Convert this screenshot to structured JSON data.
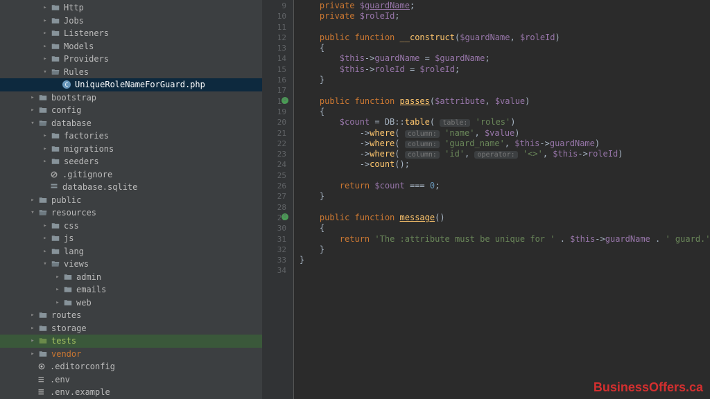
{
  "tree": [
    {
      "depth": 3,
      "chev": "right",
      "icon": "folder",
      "label": "Http"
    },
    {
      "depth": 3,
      "chev": "right",
      "icon": "folder",
      "label": "Jobs"
    },
    {
      "depth": 3,
      "chev": "right",
      "icon": "folder",
      "label": "Listeners"
    },
    {
      "depth": 3,
      "chev": "right",
      "icon": "folder",
      "label": "Models"
    },
    {
      "depth": 3,
      "chev": "right",
      "icon": "folder",
      "label": "Providers"
    },
    {
      "depth": 3,
      "chev": "down",
      "icon": "folder-open",
      "label": "Rules"
    },
    {
      "depth": 4,
      "chev": "none",
      "icon": "php",
      "label": "UniqueRoleNameForGuard.php",
      "selected": true
    },
    {
      "depth": 2,
      "chev": "right",
      "icon": "folder",
      "label": "bootstrap"
    },
    {
      "depth": 2,
      "chev": "right",
      "icon": "folder",
      "label": "config"
    },
    {
      "depth": 2,
      "chev": "down",
      "icon": "folder-open",
      "label": "database"
    },
    {
      "depth": 3,
      "chev": "right",
      "icon": "folder",
      "label": "factories"
    },
    {
      "depth": 3,
      "chev": "right",
      "icon": "folder",
      "label": "migrations"
    },
    {
      "depth": 3,
      "chev": "right",
      "icon": "folder",
      "label": "seeders"
    },
    {
      "depth": 3,
      "chev": "none",
      "icon": "gitignore",
      "label": ".gitignore"
    },
    {
      "depth": 3,
      "chev": "none",
      "icon": "db",
      "label": "database.sqlite"
    },
    {
      "depth": 2,
      "chev": "right",
      "icon": "folder",
      "label": "public"
    },
    {
      "depth": 2,
      "chev": "down",
      "icon": "folder-open",
      "label": "resources"
    },
    {
      "depth": 3,
      "chev": "right",
      "icon": "folder",
      "label": "css"
    },
    {
      "depth": 3,
      "chev": "right",
      "icon": "folder",
      "label": "js"
    },
    {
      "depth": 3,
      "chev": "right",
      "icon": "folder",
      "label": "lang"
    },
    {
      "depth": 3,
      "chev": "down",
      "icon": "folder-open",
      "label": "views"
    },
    {
      "depth": 4,
      "chev": "right",
      "icon": "folder",
      "label": "admin"
    },
    {
      "depth": 4,
      "chev": "right",
      "icon": "folder",
      "label": "emails"
    },
    {
      "depth": 4,
      "chev": "right",
      "icon": "folder",
      "label": "web"
    },
    {
      "depth": 2,
      "chev": "right",
      "icon": "folder",
      "label": "routes"
    },
    {
      "depth": 2,
      "chev": "right",
      "icon": "folder",
      "label": "storage"
    },
    {
      "depth": 2,
      "chev": "right",
      "icon": "folder-tests",
      "label": "tests",
      "tests": true
    },
    {
      "depth": 2,
      "chev": "right",
      "icon": "folder",
      "label": "vendor",
      "vendor": true
    },
    {
      "depth": 2,
      "chev": "none",
      "icon": "gear",
      "label": ".editorconfig"
    },
    {
      "depth": 2,
      "chev": "none",
      "icon": "env",
      "label": ".env"
    },
    {
      "depth": 2,
      "chev": "none",
      "icon": "env",
      "label": ".env.example"
    }
  ],
  "code": {
    "lines": [
      {
        "n": 9,
        "t": "    private $guardName;"
      },
      {
        "n": 10,
        "t": "    private $roleId;"
      },
      {
        "n": 11,
        "t": ""
      },
      {
        "n": 12,
        "t": "    public function __construct($guardName, $roleId)"
      },
      {
        "n": 13,
        "t": "    {"
      },
      {
        "n": 14,
        "t": "        $this->guardName = $guardName;"
      },
      {
        "n": 15,
        "t": "        $this->roleId = $roleId;"
      },
      {
        "n": 16,
        "t": "    }"
      },
      {
        "n": 17,
        "t": ""
      },
      {
        "n": 18,
        "t": "    public function passes($attribute, $value)",
        "icon": true
      },
      {
        "n": 19,
        "t": "    {"
      },
      {
        "n": 20,
        "t": "        $count = DB::table('roles')",
        "hint1": "table:"
      },
      {
        "n": 21,
        "t": "            ->where('name', $value)",
        "hint1": "column:"
      },
      {
        "n": 22,
        "t": "            ->where('guard_name', $this->guardName)",
        "hint1": "column:"
      },
      {
        "n": 23,
        "t": "            ->where('id', '<>', $this->roleId)",
        "hint1": "column:",
        "hint2": "operator:"
      },
      {
        "n": 24,
        "t": "            ->count();"
      },
      {
        "n": 25,
        "t": ""
      },
      {
        "n": 26,
        "t": "        return $count === 0;"
      },
      {
        "n": 27,
        "t": "    }"
      },
      {
        "n": 28,
        "t": ""
      },
      {
        "n": 29,
        "t": "    public function message()",
        "icon": true
      },
      {
        "n": 30,
        "t": "    {"
      },
      {
        "n": 31,
        "t": "        return 'The :attribute must be unique for ' . $this->guardName . ' guard.';"
      },
      {
        "n": 32,
        "t": "    }"
      },
      {
        "n": 33,
        "t": "}"
      },
      {
        "n": 34,
        "t": ""
      }
    ],
    "strings": {
      "roles": "'roles'",
      "name": "'name'",
      "guard_name": "'guard_name'",
      "id": "'id'",
      "neq": "'<>'",
      "msg1": "'The :attribute must be unique for '",
      "msg2": "' guard.'"
    },
    "hints": {
      "table": "table:",
      "column": "column:",
      "operator": "operator:"
    }
  },
  "watermark": "BusinessOffers.ca"
}
